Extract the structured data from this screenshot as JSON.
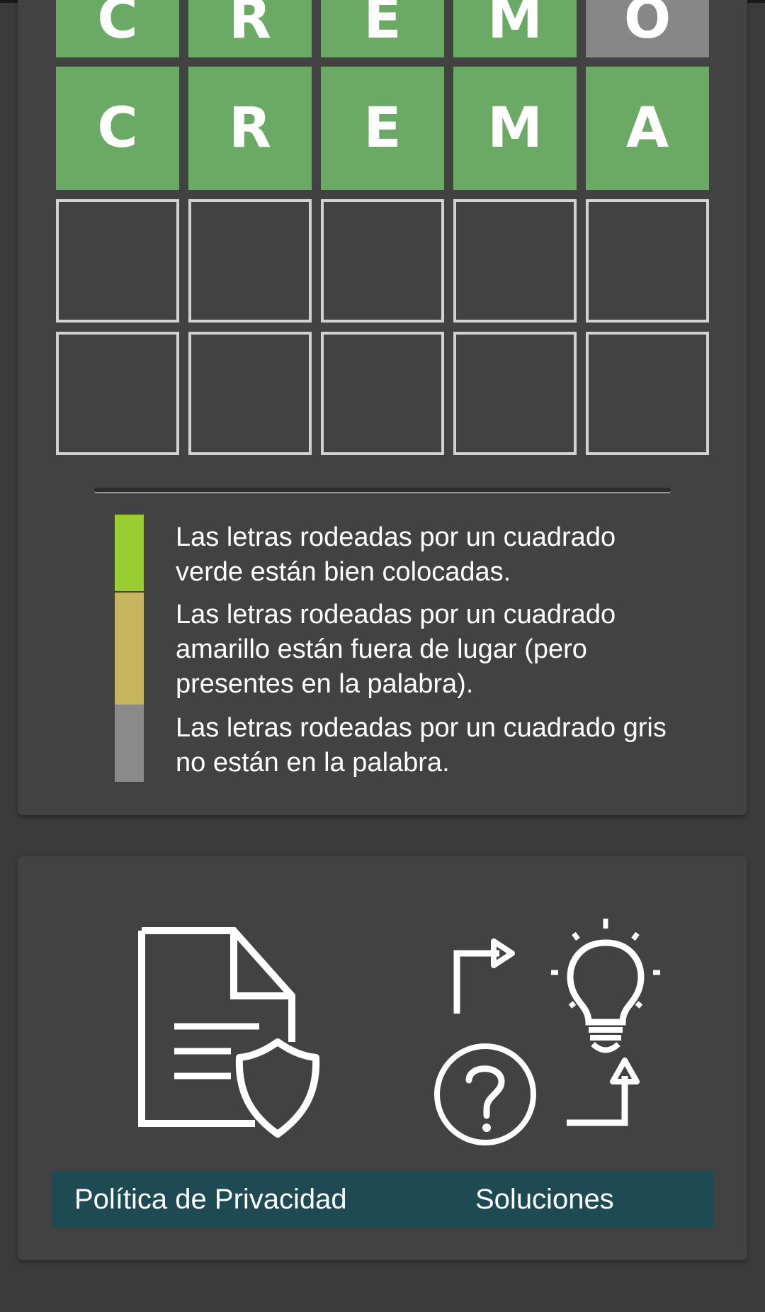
{
  "board": {
    "rows": [
      {
        "tiles": [
          {
            "letter": "C",
            "state": "correct"
          },
          {
            "letter": "R",
            "state": "correct"
          },
          {
            "letter": "E",
            "state": "correct"
          },
          {
            "letter": "M",
            "state": "correct"
          },
          {
            "letter": "O",
            "state": "absent"
          }
        ]
      },
      {
        "tiles": [
          {
            "letter": "C",
            "state": "correct"
          },
          {
            "letter": "R",
            "state": "correct"
          },
          {
            "letter": "E",
            "state": "correct"
          },
          {
            "letter": "M",
            "state": "correct"
          },
          {
            "letter": "A",
            "state": "correct"
          }
        ]
      },
      {
        "tiles": [
          {
            "letter": "",
            "state": "empty"
          },
          {
            "letter": "",
            "state": "empty"
          },
          {
            "letter": "",
            "state": "empty"
          },
          {
            "letter": "",
            "state": "empty"
          },
          {
            "letter": "",
            "state": "empty"
          }
        ]
      },
      {
        "tiles": [
          {
            "letter": "",
            "state": "empty"
          },
          {
            "letter": "",
            "state": "empty"
          },
          {
            "letter": "",
            "state": "empty"
          },
          {
            "letter": "",
            "state": "empty"
          },
          {
            "letter": "",
            "state": "empty"
          }
        ]
      }
    ]
  },
  "legend": [
    {
      "color": "#9acd32",
      "text": "Las letras rodeadas por un cuadrado verde están bien colocadas."
    },
    {
      "color": "#c8b560",
      "text": "Las letras rodeadas por un cuadrado amarillo están fuera de lugar (pero presentes en la palabra)."
    },
    {
      "color": "#8a8a8a",
      "text": "Las letras rodeadas por un cuadrado gris no están en la palabra."
    }
  ],
  "links": {
    "privacy_label": "Política de Privacidad",
    "privacy_icon": "privacy-document-shield-icon",
    "solutions_label": "Soluciones",
    "solutions_icon": "solutions-hint-icons"
  },
  "colors": {
    "correct": "#6aaa64",
    "absent": "#878787",
    "background": "#3b3b3b",
    "card": "#424242",
    "footer_bar": "#1e4a54"
  }
}
